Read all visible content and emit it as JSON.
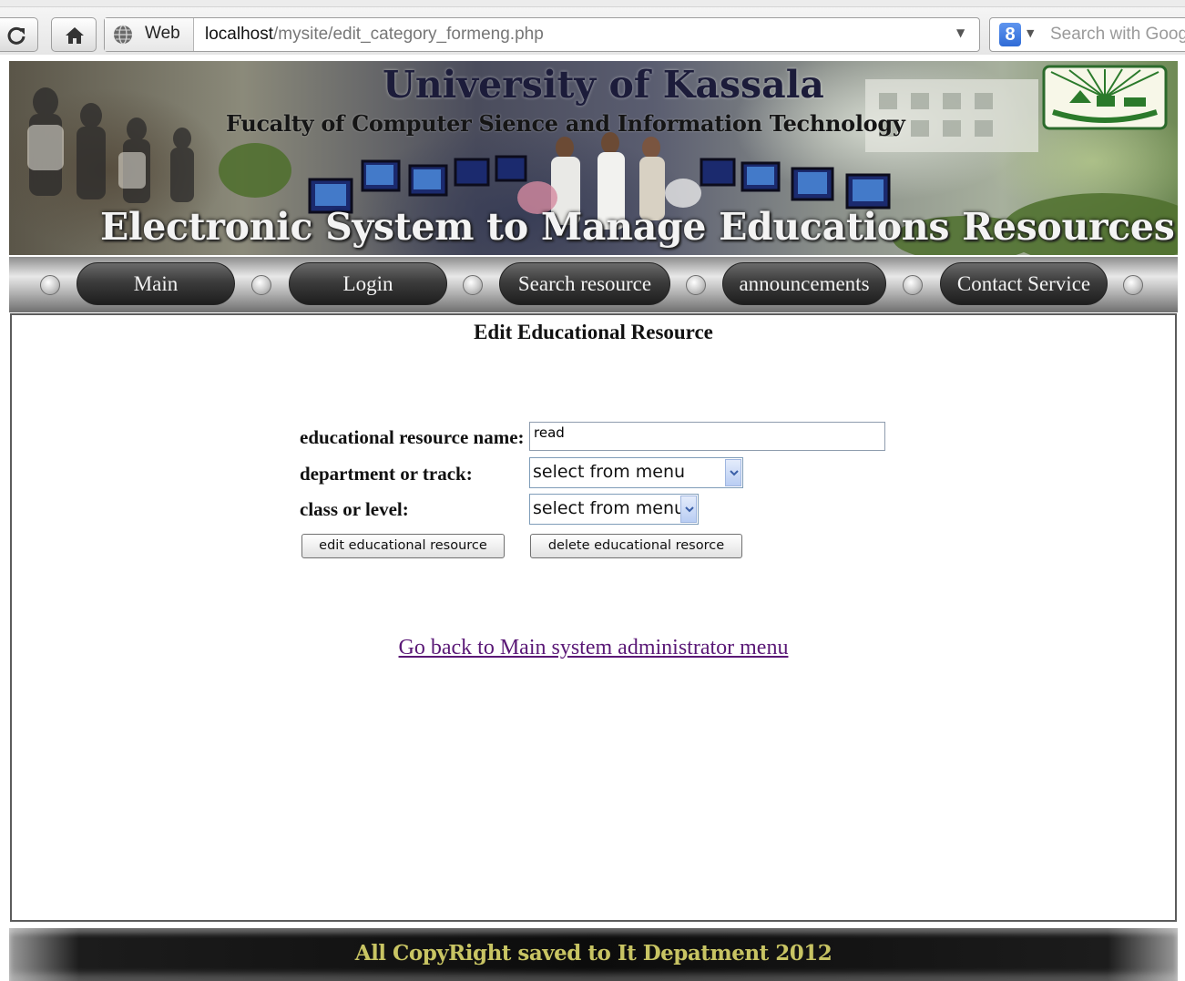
{
  "browser": {
    "web_label": "Web",
    "url_host": "localhost",
    "url_path": "/mysite/edit_category_formeng.php",
    "search_engine_letter": "8",
    "search_placeholder": "Search with Goog"
  },
  "banner": {
    "title": "University of Kassala",
    "faculty": "Fucalty of Computer Sience and Information Technology",
    "system_name": "Electronic System to Manage Educations Resources"
  },
  "nav": {
    "items": [
      {
        "label": "Main"
      },
      {
        "label": "Login"
      },
      {
        "label": "Search resource"
      },
      {
        "label": "announcements"
      },
      {
        "label": "Contact Service"
      }
    ]
  },
  "page": {
    "title": "Edit Educational Resource",
    "form": {
      "name_label": "educational resource name:",
      "name_value": "read",
      "department_label": "department or track:",
      "department_value": "select from menu",
      "class_label": "class or level:",
      "class_value": "select from menu",
      "edit_button": "edit educational resource",
      "delete_button": "delete educational resorce"
    },
    "back_link": "Go back to Main system administrator menu"
  },
  "footer": {
    "text": "All CopyRight saved to It Depatment 2012"
  }
}
